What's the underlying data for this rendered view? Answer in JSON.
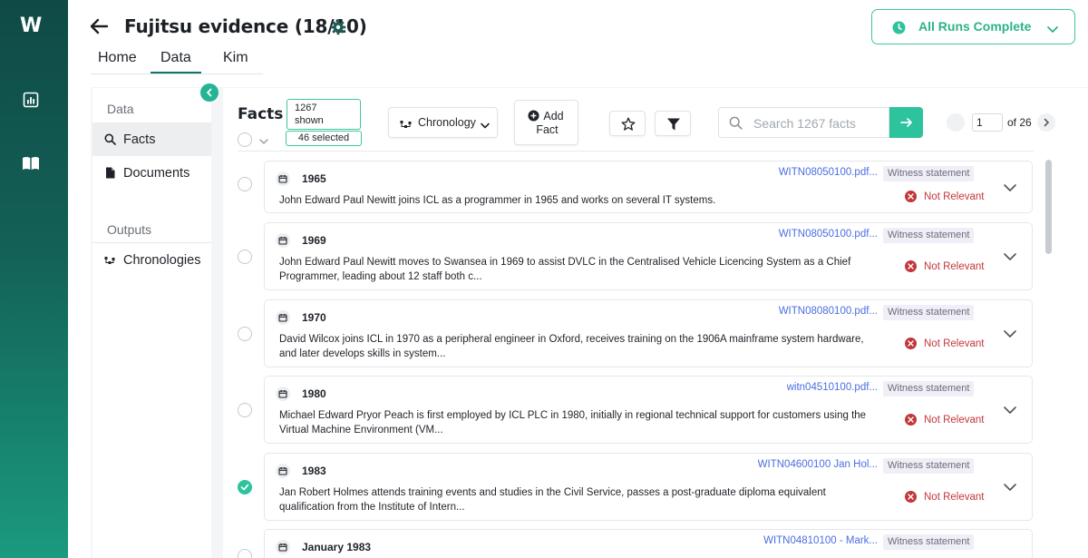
{
  "app": {
    "logo": "W",
    "title": "Fujitsu evidence (18/10)",
    "runs_status": "All Runs Complete"
  },
  "tabs": [
    {
      "label": "Home"
    },
    {
      "label": "Data"
    },
    {
      "label": "Kim"
    }
  ],
  "sidebar": {
    "data_heading": "Data",
    "items": [
      {
        "label": "Facts"
      },
      {
        "label": "Documents"
      }
    ],
    "outputs_heading": "Outputs",
    "outputs": [
      {
        "label": "Chronologies"
      }
    ]
  },
  "toolbar": {
    "title": "Facts",
    "shown_count": "1267",
    "shown_label": "shown",
    "selected_label": "46 selected",
    "chronology_label": "Chronology",
    "add_label_1": "Add",
    "add_label_2": "Fact",
    "search_placeholder": "Search 1267 facts",
    "page_value": "1",
    "page_of": "of 26"
  },
  "facts": [
    {
      "date": "1965",
      "text": "John Edward Paul Newitt joins ICL as a programmer in 1965 and works on several IT systems.",
      "source": "WITN08050100.pdf...",
      "type": "Witness statement",
      "relevance": "Not Relevant",
      "checked": false
    },
    {
      "date": "1969",
      "text": "John Edward Paul Newitt moves to Swansea in 1969 to assist DVLC in the Centralised Vehicle Licencing System as a Chief Programmer, leading about 12 staff both c...",
      "source": "WITN08050100.pdf...",
      "type": "Witness statement",
      "relevance": "Not Relevant",
      "checked": false
    },
    {
      "date": "1970",
      "text": "David Wilcox joins ICL in 1970 as a peripheral engineer in Oxford, receives training on the 1906A mainframe system hardware, and later develops skills in system...",
      "source": "WITN08080100.pdf...",
      "type": "Witness statement",
      "relevance": "Not Relevant",
      "checked": false
    },
    {
      "date": "1980",
      "text": "Michael Edward Pryor Peach is first employed by ICL PLC in 1980, initially in regional technical support for customers using the Virtual Machine Environment (VM...",
      "source": "witn04510100.pdf...",
      "type": "Witness statement",
      "relevance": "Not Relevant",
      "checked": false
    },
    {
      "date": "1983",
      "text": "Jan Robert Holmes attends training events and studies in the Civil Service, passes a post-graduate diploma equivalent qualification from the Institute of Intern...",
      "source": "WITN04600100 Jan Hol...",
      "type": "Witness statement",
      "relevance": "Not Relevant",
      "checked": true
    },
    {
      "date": "January 1983",
      "text": "",
      "source": "WITN04810100 - Mark...",
      "type": "Witness statement",
      "relevance": "",
      "checked": false
    }
  ],
  "colors": {
    "accent": "#2cc39d",
    "rail_top": "#0f4a46",
    "not_relevant": "#c2373a",
    "link": "#4a6ee0"
  }
}
